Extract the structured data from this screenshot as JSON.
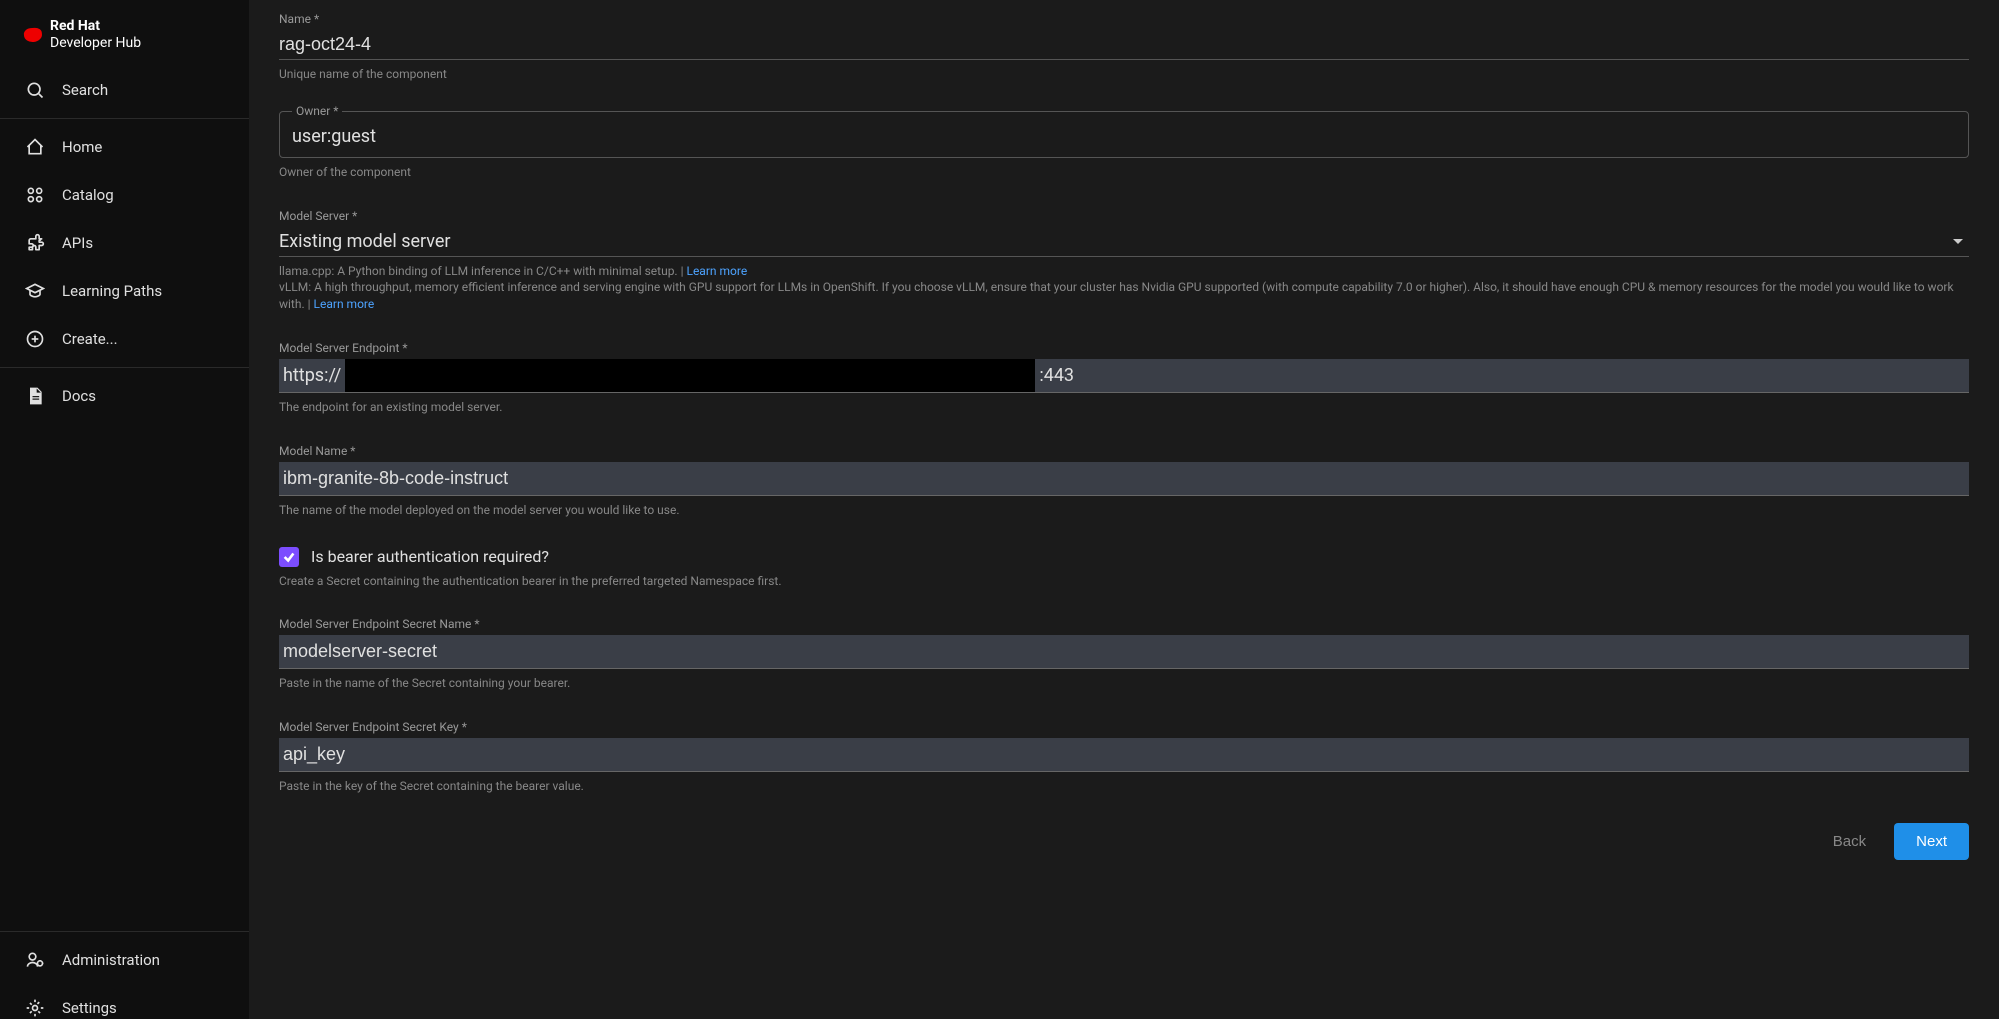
{
  "brand": {
    "line1": "Red Hat",
    "line2": "Developer Hub"
  },
  "sidebar": {
    "search": "Search",
    "home": "Home",
    "catalog": "Catalog",
    "apis": "APIs",
    "learning_paths": "Learning Paths",
    "create": "Create...",
    "docs": "Docs",
    "administration": "Administration",
    "settings": "Settings"
  },
  "form": {
    "name": {
      "label": "Name *",
      "value": "rag-oct24-4",
      "hint": "Unique name of the component"
    },
    "owner": {
      "label": "Owner *",
      "value": "user:guest",
      "hint": "Owner of the component"
    },
    "model_server": {
      "label": "Model Server *",
      "value": "Existing model server",
      "hint_llama": "llama.cpp: A Python binding of LLM inference in C/C++ with minimal setup. | ",
      "hint_vllm": "vLLM: A high throughput, memory efficient inference and serving engine with GPU support for LLMs in OpenShift. If you choose vLLM, ensure that your cluster has Nvidia GPU supported (with compute capability 7.0 or higher). Also, it should have enough CPU & memory resources for the model you would like to work with. | ",
      "learn_more": "Learn more"
    },
    "endpoint": {
      "label": "Model Server Endpoint *",
      "prefix": "https://",
      "suffix": ":443",
      "hint": "The endpoint for an existing model server."
    },
    "model_name": {
      "label": "Model Name *",
      "value": "ibm-granite-8b-code-instruct",
      "hint": "The name of the model deployed on the model server you would like to use."
    },
    "bearer": {
      "label": "Is bearer authentication required?",
      "hint": "Create a Secret containing the authentication bearer in the preferred targeted Namespace first."
    },
    "secret_name": {
      "label": "Model Server Endpoint Secret Name *",
      "value": "modelserver-secret",
      "hint": "Paste in the name of the Secret containing your bearer."
    },
    "secret_key": {
      "label": "Model Server Endpoint Secret Key *",
      "value": "api_key",
      "hint": "Paste in the key of the Secret containing the bearer value."
    }
  },
  "buttons": {
    "back": "Back",
    "next": "Next"
  }
}
